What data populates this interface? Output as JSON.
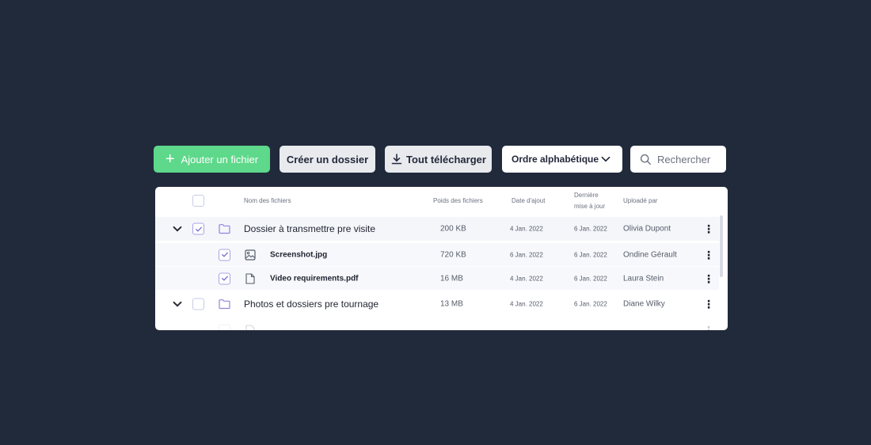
{
  "toolbar": {
    "add_label": "Ajouter un fichier",
    "folder_label": "Créer un dossier",
    "download_label": "Tout télécharger",
    "sort_label": "Ordre alphabétique",
    "search_placeholder": "Rechercher"
  },
  "table": {
    "headers": {
      "name": "Nom des fichiers",
      "size": "Poids des fichiers",
      "added": "Date d'ajout",
      "updated_1": "Dernière",
      "updated_2": "mise à jour",
      "uploader": "Uploadé par"
    },
    "rows": [
      {
        "name": "Dossier à transmettre pre visite",
        "size": "200 KB",
        "added": "4 Jan. 2022",
        "updated": "6 Jan. 2022",
        "uploader": "Olivia Dupont"
      },
      {
        "name": "Screenshot.jpg",
        "size": "720 KB",
        "added": "6 Jan. 2022",
        "updated": "6 Jan. 2022",
        "uploader": "Ondine Gérault"
      },
      {
        "name": "Video requirements.pdf",
        "size": "16 MB",
        "added": "4 Jan. 2022",
        "updated": "6 Jan. 2022",
        "uploader": "Laura Stein"
      },
      {
        "name": "Photos et dossiers pre tournage",
        "size": "13 MB",
        "added": "4 Jan. 2022",
        "updated": "6 Jan. 2022",
        "uploader": "Diane Wilky"
      }
    ]
  },
  "colors": {
    "background": "#212a3b",
    "accent_green": "#5ed88a",
    "accent_purple": "#7b6fd6"
  }
}
